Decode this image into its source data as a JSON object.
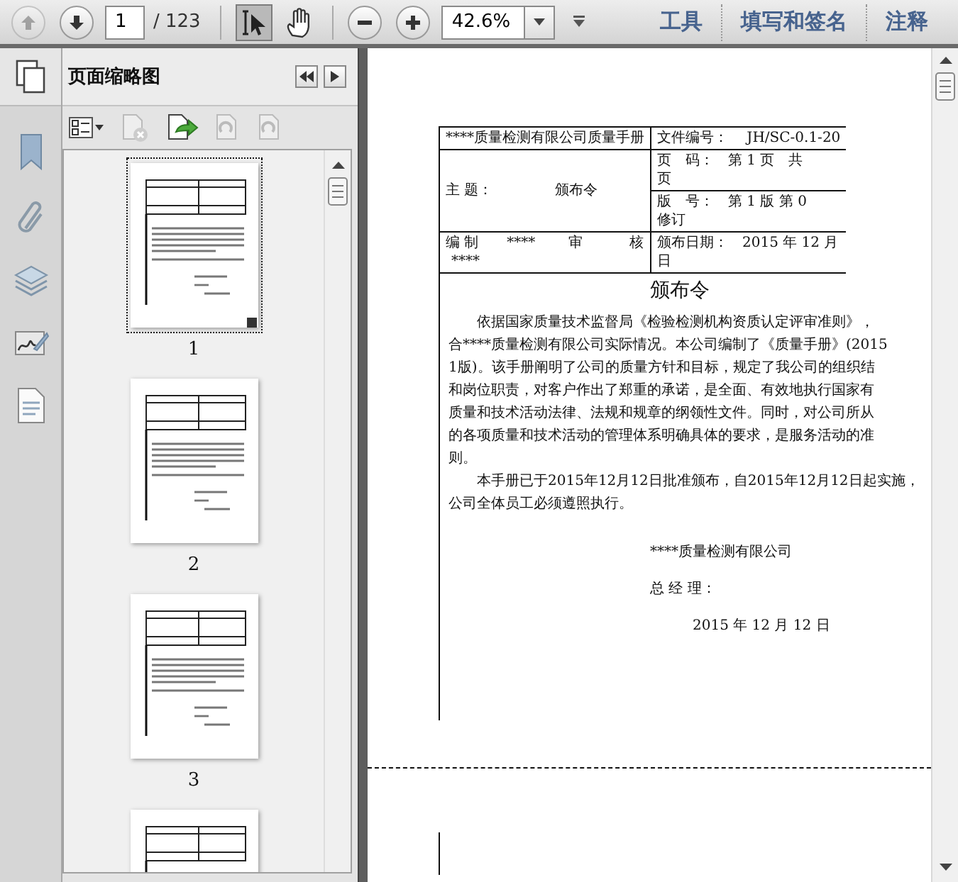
{
  "toolbar": {
    "prev_page": {
      "disabled": true
    },
    "next_page": {
      "disabled": false
    },
    "page_number": "1",
    "page_count": "/ 123",
    "tools": [
      {
        "kind": "select",
        "selected": true
      },
      {
        "kind": "hand",
        "selected": false
      }
    ],
    "zoom": "42.6%",
    "tabs": [
      "工具",
      "填写和签名",
      "注释"
    ]
  },
  "panel": {
    "title": "页面缩略图",
    "thumbnails": [
      {
        "label": "1",
        "selected": true
      },
      {
        "label": "2",
        "selected": false
      },
      {
        "label": "3",
        "selected": false
      },
      {
        "selected": false
      }
    ]
  },
  "document": {
    "header_table": {
      "company": "****质量检测有限公司质量手册",
      "file_no": "文件编号：　 JH/SC-0.1-20",
      "subject_label": "主 题：",
      "subject": "颁布令",
      "page_info": [
        "页　码：　第 1 页　共",
        "页"
      ],
      "version": [
        "版　号：　第 1 版 第 0",
        "修订"
      ],
      "prepared": "编 制　　****　　 审　　　 核",
      "prepared_by": "****",
      "date": [
        "颁布日期：　2015 年 12 月",
        "日"
      ]
    },
    "title": "颁布令",
    "paragraphs": [
      [
        "依据国家质量技术监督局《检验检测机构资质认定评审准则》，",
        "合****质量检测有限公司实际情况。本公司编制了《质量手册》(2015",
        "1版)。该手册阐明了公司的质量方针和目标，规定了我公司的组织结",
        "和岗位职责，对客户作出了郑重的承诺，是全面、有效地执行国家有",
        "质量和技术活动法律、法规和规章的纲领性文件。同时，对公司所从",
        "的各项质量和技术活动的管理体系明确具体的要求，是服务活动的准",
        "则。"
      ],
      [
        "本手册已于2015年12月12日批准颁布，自2015年12月12日起实施，",
        "公司全体员工必须遵照执行。"
      ]
    ],
    "signature": {
      "company": "****质量检测有限公司",
      "manager": "总 经 理：",
      "date": "2015 年 12 月 12 日"
    }
  }
}
